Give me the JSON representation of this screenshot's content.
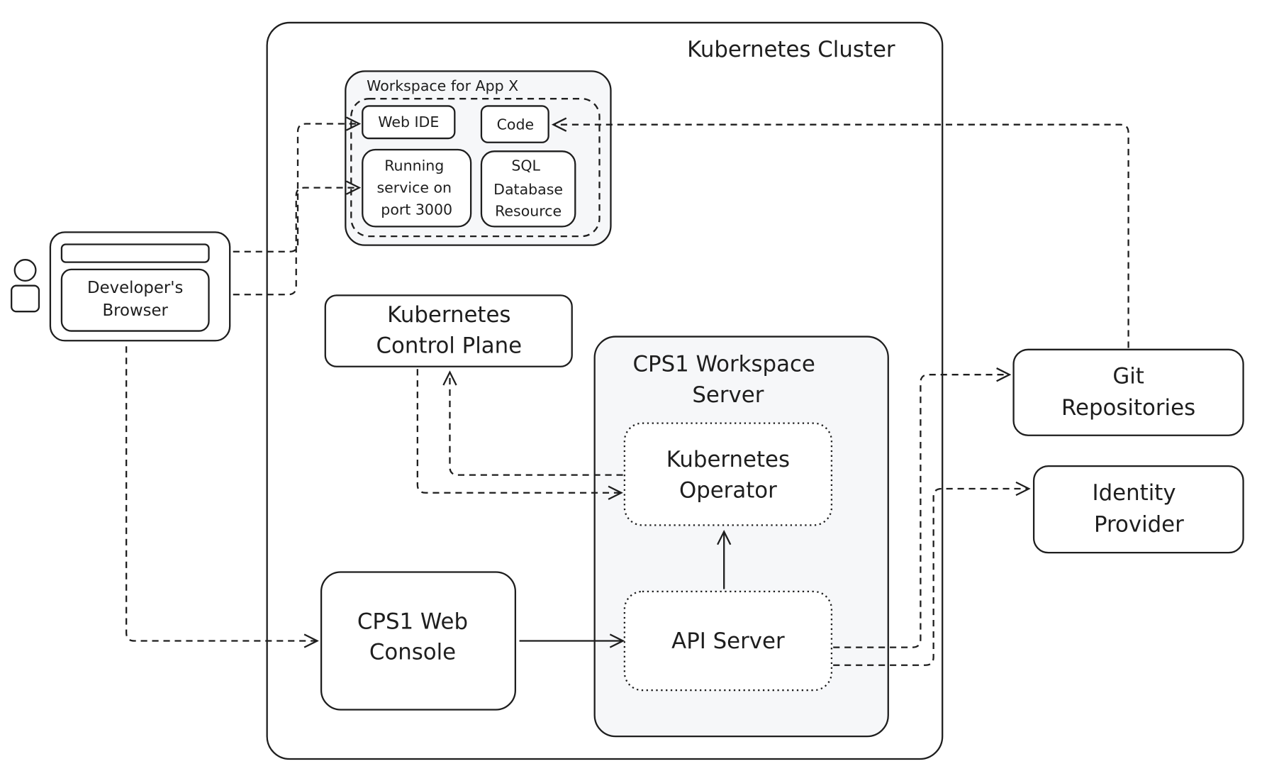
{
  "cluster": {
    "title": "Kubernetes Cluster"
  },
  "workspace": {
    "title": "Workspace for App X",
    "web_ide": "Web IDE",
    "code": "Code",
    "running": [
      "Running",
      "service on",
      "port 3000"
    ],
    "sql": [
      "SQL",
      "Database",
      "Resource"
    ]
  },
  "browser": {
    "label": [
      "Developer's",
      "Browser"
    ]
  },
  "control_plane": {
    "label": [
      "Kubernetes",
      "Control Plane"
    ]
  },
  "cps1_server": {
    "label": [
      "CPS1 Workspace",
      "Server"
    ]
  },
  "operator": {
    "label": [
      "Kubernetes",
      "Operator"
    ]
  },
  "api_server": {
    "label": "API Server"
  },
  "web_console": {
    "label": [
      "CPS1 Web",
      "Console"
    ]
  },
  "git": {
    "label": [
      "Git",
      "Repositories"
    ]
  },
  "idp": {
    "label": [
      "Identity",
      "Provider"
    ]
  },
  "colors": {
    "stroke": "#1e1e1e",
    "panel": "#f6f7f9",
    "workspace_inner": "#e9ecef"
  }
}
